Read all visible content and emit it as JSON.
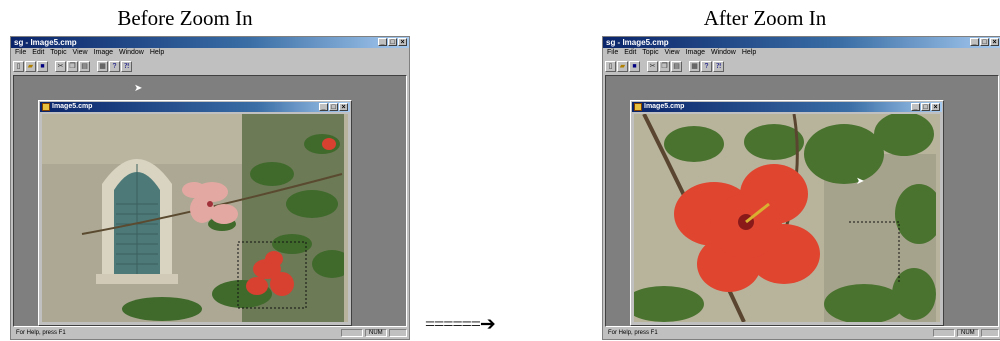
{
  "captions": {
    "before": "Before Zoom In",
    "after": "After Zoom In"
  },
  "connector": {
    "equals": "======",
    "arrow_icon": "right-arrow-icon"
  },
  "window": {
    "title": "sg - Image5.cmp",
    "menu": [
      "File",
      "Edit",
      "Topic",
      "View",
      "Image",
      "Window",
      "Help"
    ],
    "toolbar_icons": [
      "new-icon",
      "open-icon",
      "save-icon",
      "cut-icon",
      "copy-icon",
      "paste-icon",
      "print-icon",
      "help-icon",
      "context-help-icon"
    ],
    "child_title": "Image5.cmp",
    "status_text": "For Help, press F1",
    "status_num": "NUM"
  },
  "colors": {
    "title_active": "#0a246a",
    "workspace": "#7f7f7f",
    "window_face": "#c0c0c0"
  }
}
